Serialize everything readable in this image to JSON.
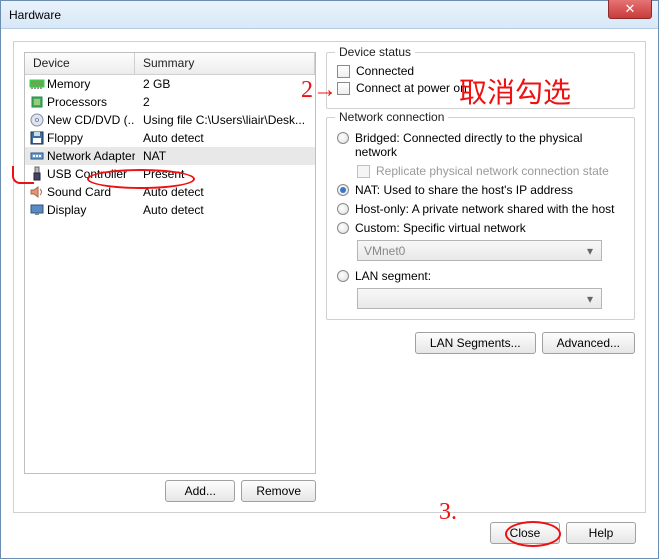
{
  "window": {
    "title": "Hardware"
  },
  "list": {
    "headers": {
      "device": "Device",
      "summary": "Summary"
    },
    "rows": [
      {
        "icon": "memory-icon",
        "device": "Memory",
        "summary": "2 GB"
      },
      {
        "icon": "cpu-icon",
        "device": "Processors",
        "summary": "2"
      },
      {
        "icon": "cd-icon",
        "device": "New CD/DVD (...",
        "summary": "Using file C:\\Users\\liair\\Desk..."
      },
      {
        "icon": "floppy-icon",
        "device": "Floppy",
        "summary": "Auto detect"
      },
      {
        "icon": "net-icon",
        "device": "Network Adapter",
        "summary": "NAT",
        "selected": true
      },
      {
        "icon": "usb-icon",
        "device": "USB Controller",
        "summary": "Present"
      },
      {
        "icon": "sound-icon",
        "device": "Sound Card",
        "summary": "Auto detect"
      },
      {
        "icon": "display-icon",
        "device": "Display",
        "summary": "Auto detect"
      }
    ]
  },
  "buttons": {
    "add": "Add...",
    "remove": "Remove",
    "lan_segments": "LAN Segments...",
    "advanced": "Advanced...",
    "close": "Close",
    "help": "Help"
  },
  "device_status": {
    "title": "Device status",
    "connected": "Connected",
    "connect_power": "Connect at power on"
  },
  "net_conn": {
    "title": "Network connection",
    "bridged": "Bridged: Connected directly to the physical network",
    "replicate": "Replicate physical network connection state",
    "nat": "NAT: Used to share the host's IP address",
    "hostonly": "Host-only: A private network shared with the host",
    "custom": "Custom: Specific virtual network",
    "custom_value": "VMnet0",
    "lan_segment": "LAN segment:",
    "lan_value": ""
  },
  "annotations": {
    "two_arrow": "2→",
    "cn": "取消勾选",
    "three": "3."
  }
}
